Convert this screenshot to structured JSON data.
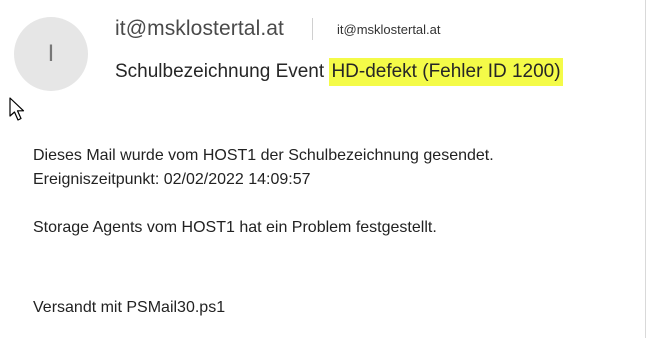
{
  "email": {
    "avatar_initial": "I",
    "from_name": "it@msklostertal.at",
    "from_address": "it@msklostertal.at",
    "subject_plain": "Schulbezeichnung Event ",
    "subject_highlighted": "HD-defekt (Fehler ID 1200)",
    "highlight_color": "#f4fb48",
    "body_lines": [
      "Dieses Mail wurde vom HOST1 der Schulbezeichnung gesendet.",
      "Ereigniszeitpunkt: 02/02/2022 14:09:57",
      "Storage Agents vom HOST1 hat ein Problem festgestellt.",
      "Versandt mit PSMail30.ps1"
    ]
  },
  "icons": {
    "cursor": "mouse-pointer-icon"
  }
}
